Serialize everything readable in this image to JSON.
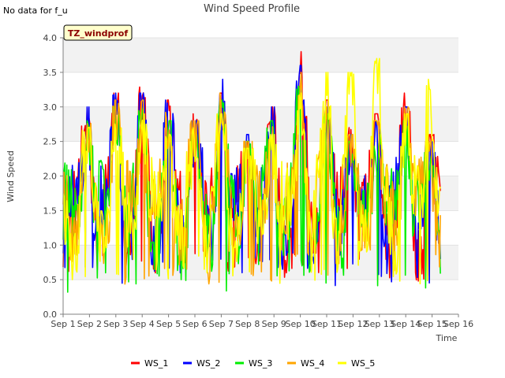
{
  "note": "No data for f_u",
  "colors": {
    "background": "#ffffff",
    "plot_band": "#f2f2f2",
    "grid": "#dcdcdc",
    "site_box_fill": "#ffffcc",
    "site_text": "#8b0000"
  },
  "chart_data": {
    "type": "line",
    "title": "Wind Speed Profile",
    "xlabel": "Time",
    "ylabel": "Wind Speed",
    "site_label": "TZ_windprof",
    "xlim": [
      1,
      16
    ],
    "ylim": [
      0.0,
      4.0
    ],
    "grid": true,
    "legend_position": "bottom",
    "x_ticks": [
      "Sep 1",
      "Sep 2",
      "Sep 3",
      "Sep 4",
      "Sep 5",
      "Sep 6",
      "Sep 7",
      "Sep 8",
      "Sep 9",
      "Sep 10",
      "Sep 11",
      "Sep 12",
      "Sep 13",
      "Sep 14",
      "Sep 15",
      "Sep 16"
    ],
    "y_ticks": [
      "0.0",
      "0.5",
      "1.0",
      "1.5",
      "2.0",
      "2.5",
      "3.0",
      "3.5",
      "4.0"
    ],
    "daily_peaks": {
      "x": [
        1.9,
        3.0,
        4.0,
        5.0,
        6.0,
        7.0,
        8.0,
        8.9,
        10.0,
        11.0,
        11.9,
        12.9,
        14.0,
        14.9
      ],
      "WS_1": [
        3.1,
        3.2,
        3.3,
        3.1,
        2.9,
        3.2,
        2.5,
        3.0,
        3.8,
        3.1,
        2.7,
        2.9,
        3.2,
        2.6
      ],
      "WS_2": [
        3.0,
        3.2,
        3.2,
        3.1,
        2.8,
        3.4,
        2.6,
        3.0,
        3.6,
        3.0,
        2.6,
        2.8,
        3.0,
        2.5
      ],
      "WS_3": [
        2.8,
        3.0,
        3.0,
        2.8,
        2.6,
        3.1,
        2.5,
        2.8,
        3.3,
        2.9,
        2.5,
        2.6,
        2.8,
        2.4
      ],
      "WS_4": [
        2.9,
        3.1,
        3.1,
        3.0,
        2.8,
        3.2,
        2.5,
        2.9,
        3.5,
        3.0,
        2.6,
        2.8,
        3.0,
        2.5
      ],
      "WS_5": [
        2.7,
        2.8,
        2.9,
        2.6,
        2.7,
        2.9,
        2.4,
        2.6,
        3.2,
        3.5,
        3.5,
        3.7,
        2.9,
        3.4
      ]
    },
    "daily_minima": {
      "WS_1": [
        0.6,
        0.3,
        0.5,
        0.6,
        0.7,
        0.5,
        0.6,
        0.5,
        0.6,
        0.4,
        0.5,
        0.4,
        0.4,
        0.4
      ],
      "WS_2": [
        0.6,
        0.4,
        0.5,
        0.6,
        0.7,
        0.5,
        0.6,
        0.5,
        0.6,
        0.4,
        0.5,
        0.4,
        0.4,
        0.4
      ],
      "WS_3": [
        0.3,
        0.3,
        0.3,
        0.5,
        0.4,
        0.3,
        0.5,
        0.3,
        0.5,
        0.4,
        0.5,
        0.4,
        0.3,
        0.3
      ],
      "WS_4": [
        0.6,
        0.4,
        0.4,
        0.5,
        0.6,
        0.4,
        0.5,
        0.4,
        0.6,
        0.4,
        0.5,
        0.4,
        0.4,
        0.4
      ],
      "WS_5": [
        0.5,
        0.4,
        0.4,
        0.5,
        0.6,
        0.4,
        0.5,
        0.4,
        0.6,
        0.4,
        0.5,
        0.4,
        0.4,
        0.4
      ]
    },
    "series": [
      {
        "name": "WS_1",
        "color": "#ff0000"
      },
      {
        "name": "WS_2",
        "color": "#0000ff"
      },
      {
        "name": "WS_3",
        "color": "#00ee00"
      },
      {
        "name": "WS_4",
        "color": "#ffa500"
      },
      {
        "name": "WS_5",
        "color": "#ffff00"
      }
    ]
  }
}
